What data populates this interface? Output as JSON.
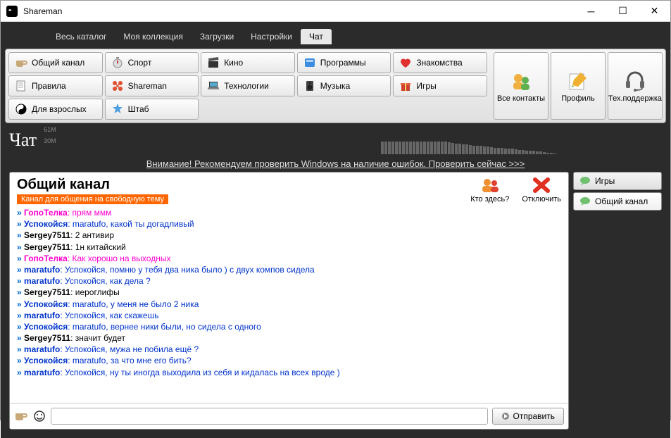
{
  "window": {
    "title": "Shareman"
  },
  "menu": {
    "items": [
      "Весь каталог",
      "Моя коллекция",
      "Загрузки",
      "Настройки",
      "Чат"
    ],
    "activeIndex": 4
  },
  "toolbar": {
    "channels": [
      {
        "label": "Общий канал",
        "icon": "coffee"
      },
      {
        "label": "Спорт",
        "icon": "stopwatch"
      },
      {
        "label": "Кино",
        "icon": "clapper"
      },
      {
        "label": "Программы",
        "icon": "bluebox"
      },
      {
        "label": "Знакомства",
        "icon": "heart"
      },
      {
        "label": "Правила",
        "icon": "doc"
      },
      {
        "label": "Shareman",
        "icon": "shareman"
      },
      {
        "label": "Технологии",
        "icon": "laptop"
      },
      {
        "label": "Музыка",
        "icon": "speaker"
      },
      {
        "label": "Игры",
        "icon": "gift"
      },
      {
        "label": "Для взрослых",
        "icon": "yinyang"
      },
      {
        "label": "Штаб",
        "icon": "star"
      }
    ],
    "big": [
      {
        "label": "Все контакты",
        "icon": "contacts"
      },
      {
        "label": "Профиль",
        "icon": "profile"
      },
      {
        "label": "Тех.поддержка",
        "icon": "headset"
      }
    ]
  },
  "chatHeader": {
    "title": "Чат",
    "chartTop": "61M",
    "chartMid": "30M"
  },
  "chart_data": {
    "type": "bar",
    "title": "activity",
    "categories": [],
    "values": [
      30,
      30,
      30,
      30,
      30,
      30,
      30,
      30,
      30,
      30,
      30,
      30,
      30,
      30,
      30,
      30,
      30,
      30,
      30,
      28,
      27,
      26,
      26,
      24,
      23,
      22,
      21,
      20,
      20,
      19,
      18,
      17,
      16,
      15,
      15,
      14,
      14,
      13,
      12,
      11,
      10,
      9,
      8,
      8,
      7,
      6,
      5,
      4,
      3,
      2
    ],
    "ylim": [
      0,
      61
    ]
  },
  "notice": {
    "text": "Внимание! Рекомендуем проверить Windows на наличие ошибок. Проверить сейчас >>>"
  },
  "channel": {
    "name": "Общий канал",
    "desc": "Канал для общения на свободную тему",
    "actions": {
      "who": "Кто здесь?",
      "disconnect": "Отключить"
    }
  },
  "messages": [
    {
      "user": "ГопоТелка",
      "ustyle": "pink",
      "text": "прям ммм",
      "tstyle": "pink"
    },
    {
      "user": "Успокойся",
      "ustyle": "blue",
      "text": "maratufo, какой ты догадливый",
      "tstyle": "blue"
    },
    {
      "user": "Sergey7511",
      "ustyle": "black",
      "text": "2 антивир",
      "tstyle": "black"
    },
    {
      "user": "Sergey7511",
      "ustyle": "black",
      "text": "1н китайский",
      "tstyle": "black"
    },
    {
      "user": "ГопоТелка",
      "ustyle": "pink",
      "text": "Как хорошо на выходных",
      "tstyle": "pink"
    },
    {
      "user": "maratufo",
      "ustyle": "blue",
      "text": "Успокойся, помню у тебя два ника было ) с двух компов сидела",
      "tstyle": "blue"
    },
    {
      "user": "maratufo",
      "ustyle": "blue",
      "text": "Успокойся, как дела ?",
      "tstyle": "blue"
    },
    {
      "user": "Sergey7511",
      "ustyle": "black",
      "text": "иероглифы",
      "tstyle": "black"
    },
    {
      "user": "Успокойся",
      "ustyle": "blue",
      "text": "maratufo, у меня не было 2 ника",
      "tstyle": "blue"
    },
    {
      "user": "maratufo",
      "ustyle": "blue",
      "text": "Успокойся, как скажешь",
      "tstyle": "blue"
    },
    {
      "user": "Успокойся",
      "ustyle": "blue",
      "text": "maratufo, вернее ники были, но сидела с одного",
      "tstyle": "blue"
    },
    {
      "user": "Sergey7511",
      "ustyle": "black",
      "text": "значит будет",
      "tstyle": "black"
    },
    {
      "user": "maratufo",
      "ustyle": "blue",
      "text": "Успокойся, мужа не побила ещё ?",
      "tstyle": "blue"
    },
    {
      "user": "Успокойся",
      "ustyle": "blue",
      "text": "maratufo, за что мне его бить?",
      "tstyle": "blue"
    },
    {
      "user": "maratufo",
      "ustyle": "blue",
      "text": "Успокойся, ну ты иногда выходила из себя и кидалась на всех вроде )",
      "tstyle": "blue"
    }
  ],
  "input": {
    "send": "Отправить"
  },
  "sidebar": {
    "items": [
      {
        "label": "Игры",
        "active": false
      },
      {
        "label": "Общий канал",
        "active": true
      }
    ]
  }
}
